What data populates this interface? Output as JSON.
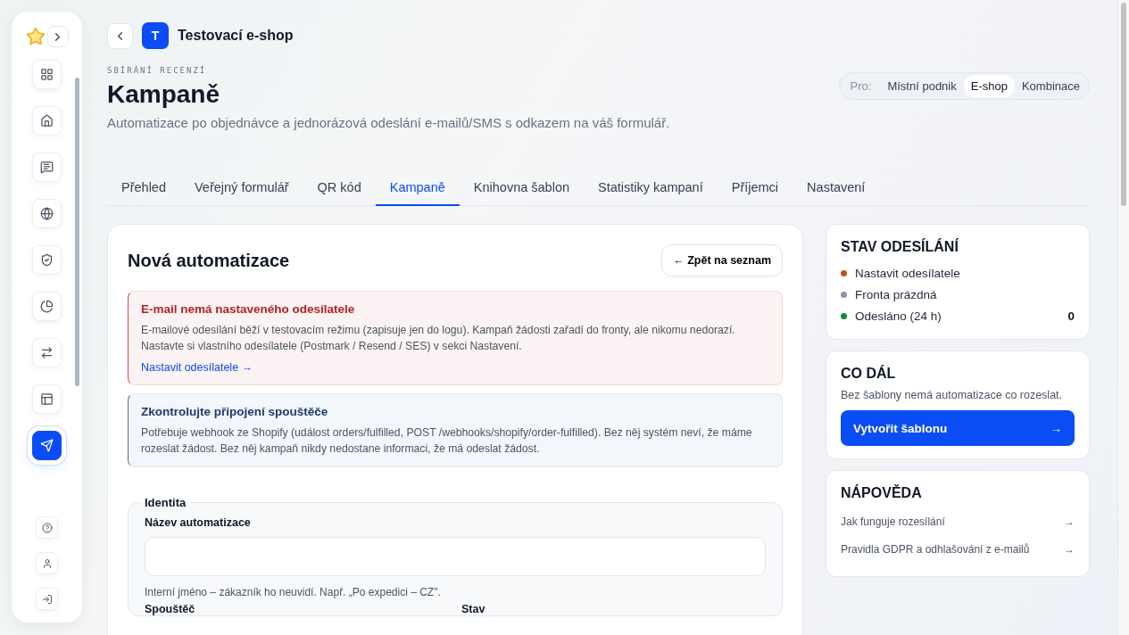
{
  "sidebar": {
    "items": [
      {
        "selected": false
      },
      {
        "selected": false
      },
      {
        "selected": false
      },
      {
        "selected": false
      },
      {
        "selected": false
      },
      {
        "selected": false
      },
      {
        "selected": false
      },
      {
        "selected": false
      },
      {
        "selected": true
      }
    ],
    "bottom_items": [
      {
        "selected": false
      },
      {
        "selected": false
      },
      {
        "selected": false
      }
    ]
  },
  "header": {
    "shop_initial": "T",
    "shop_name": "Testovací e-shop",
    "eyebrow": "SBÍRÁNÍ RECENZÍ",
    "title": "Kampaně",
    "subtitle": "Automatizace po objednávce a jednorázová odeslání e-mailů/SMS s odkazem na váš formulář.",
    "audience_label": "Pro:",
    "audience_options": [
      {
        "label": "Místní podnik",
        "selected": false
      },
      {
        "label": "E-shop",
        "selected": true
      },
      {
        "label": "Kombinace",
        "selected": false
      }
    ]
  },
  "tabs": [
    {
      "label": "Přehled",
      "selected": false
    },
    {
      "label": "Veřejný formulář",
      "selected": false
    },
    {
      "label": "QR kód",
      "selected": false
    },
    {
      "label": "Kampaně",
      "selected": true
    },
    {
      "label": "Knihovna šablon",
      "selected": false
    },
    {
      "label": "Statistiky kampaní",
      "selected": false
    },
    {
      "label": "Příjemci",
      "selected": false
    },
    {
      "label": "Nastavení",
      "selected": false
    }
  ],
  "form": {
    "title": "Nová automatizace",
    "back_button": "← Zpět na seznam",
    "alerts": [
      {
        "kind": "error",
        "title": "E-mail nemá nastaveného odesílatele",
        "text": "E-mailové odesílání běží v testovacím režimu (zapisuje jen do logu). Kampaň žádosti zařadí do fronty, ale nikomu nedorazí. Nastavte si vlastního odesílatele (Postmark / Resend / SES) v sekci Nastavení.",
        "link": "Nastavit odesílatele →"
      },
      {
        "kind": "info",
        "title": "Zkontrolujte připojení spouštěče",
        "text": "Potřebuje webhook ze Shopify (událost orders/fulfilled, POST /webhooks/shopify/order-fulfilled). Bez něj systém neví, že máme rozeslat žádost. Bez něj kampaň nikdy nedostane informaci, že má odeslat žádost."
      }
    ],
    "section": {
      "legend": "Identita",
      "name_label": "Název automatizace",
      "name_hint": "Interní jméno – zákazník ho neuvidí. Např. „Po expedici – CZ\".",
      "trigger_label": "Spouštěč",
      "status_label": "Stav"
    }
  },
  "status_card": {
    "title": "STAV ODESÍLÁNÍ",
    "items": [
      {
        "label": "Nastavit odesílatele",
        "color": "#c2501e"
      },
      {
        "label": "Fronta prázdná",
        "color": "#8a94a6"
      },
      {
        "label": "Odesláno (24 h)",
        "color": "#0f8a3c",
        "value": "0"
      }
    ]
  },
  "next_card": {
    "title": "CO DÁL",
    "text": "Bez šablony nemá automatizace co rozeslat.",
    "button": "Vytvořit šablonu",
    "button_arrow": "→"
  },
  "help_card": {
    "title": "NÁPOVĚDA",
    "links": [
      {
        "label": "Jak funguje rozesílání",
        "arrow": "→"
      },
      {
        "label": "Pravidla GDPR a odhlašování z e-mailů",
        "arrow": "→"
      }
    ]
  }
}
